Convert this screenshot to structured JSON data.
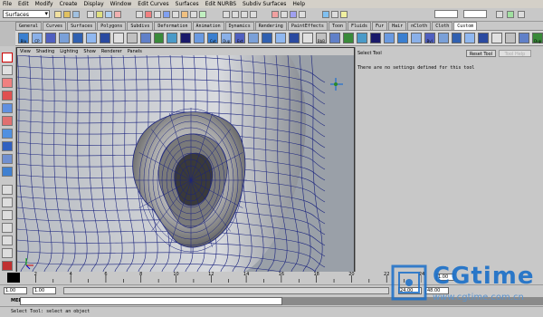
{
  "menubar": {
    "items": [
      "File",
      "Edit",
      "Modify",
      "Create",
      "Display",
      "Window",
      "Edit Curves",
      "Surfaces",
      "Edit NURBS",
      "Subdiv Surfaces",
      "Help"
    ]
  },
  "statusline": {
    "mode": "Surfaces"
  },
  "shelf": {
    "tabs": [
      "General",
      "Curves",
      "Surfaces",
      "Polygons",
      "Subdivs",
      "Deformation",
      "Animation",
      "Dynamics",
      "Rendering",
      "PaintEffects",
      "Toon",
      "Fluids",
      "Fur",
      "Hair",
      "nCloth",
      "Cloth",
      "Custom"
    ],
    "active_tab": "Custom",
    "buttons": [
      "Blu",
      "CP",
      "",
      "",
      "",
      "",
      "",
      "",
      "",
      "",
      "",
      "",
      "",
      "",
      "Cut",
      "Dup",
      "Ext",
      "",
      "",
      "",
      "",
      "",
      "BbB",
      "",
      "",
      "",
      "",
      "",
      "",
      "",
      "Bvl",
      "",
      "",
      "",
      "",
      "",
      "",
      "",
      "Dup"
    ]
  },
  "viewport": {
    "panel_menu": [
      "View",
      "Shading",
      "Lighting",
      "Show",
      "Renderer",
      "Panels"
    ]
  },
  "tool_settings": {
    "title": "Select Tool",
    "reset_label": "Reset Tool",
    "help_label": "Tool Help",
    "message": "There are no settings defined for this tool"
  },
  "timeslider": {
    "ticks": [
      "2",
      "4",
      "6",
      "8",
      "10",
      "12",
      "14",
      "16",
      "18",
      "20",
      "22",
      "24"
    ],
    "current_frame": "1.00"
  },
  "rangeslider": {
    "start": "1.00",
    "start2": "1.00",
    "end": "24.00",
    "end2": "48.00"
  },
  "cmdline": {
    "label": "MEL"
  },
  "helpline": {
    "text": "Select Tool: select an object"
  },
  "watermark": {
    "logo": "CGtime",
    "url": "www.cgtime.com.cn"
  },
  "colors": {
    "wire": "#1a237e",
    "viewport_bg": "#9aa0a8",
    "ui_bg": "#c8c8c8"
  }
}
